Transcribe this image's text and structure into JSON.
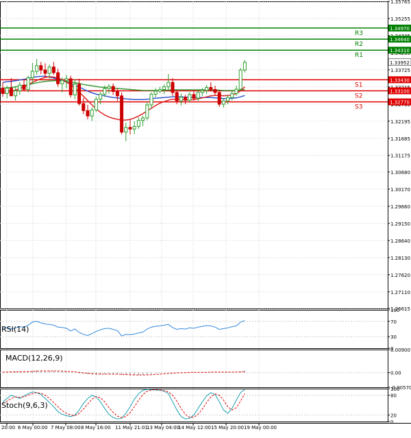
{
  "chart_data": {
    "type": "candlestick",
    "symbol_panel": "main",
    "colors": {
      "background": "#ffffff",
      "grid": "#cfcfcf",
      "bull": "#2e9e2e",
      "bear": "#cc0000",
      "resistance": "#008000",
      "support": "#e00000",
      "ma_blue": "#3355cc",
      "ma_green": "#3a9a3a",
      "ma_red": "#dd2222",
      "rsi_line": "#3388dd",
      "macd_signal": "#e00000",
      "macd_hist": "#888888",
      "stoch_main": "#1aa0b0",
      "stoch_signal": "#e00000",
      "price_tag": "#e00000",
      "last_price_bg": "#ffffff"
    },
    "price_axis_ticks": [
      "1.35765",
      "1.35255",
      "1.34745",
      "1.34235",
      "1.33725",
      "1.33215",
      "1.32705",
      "1.32195",
      "1.31685",
      "1.31175",
      "1.30680",
      "1.30170",
      "1.29660",
      "1.29150",
      "1.28640",
      "1.28130",
      "1.27620",
      "1.27110",
      "1.26615"
    ],
    "ylim": [
      1.26615,
      1.35765
    ],
    "levels": [
      {
        "name": "R3",
        "value": 1.3497,
        "label": "1.34970",
        "kind": "resistance"
      },
      {
        "name": "R2",
        "value": 1.3464,
        "label": "1.34640",
        "kind": "resistance"
      },
      {
        "name": "R1",
        "value": 1.3431,
        "label": "1.34310",
        "kind": "resistance"
      },
      {
        "name": "S1",
        "value": 1.3343,
        "label": "1.33430",
        "kind": "support"
      },
      {
        "name": "S2",
        "value": 1.331,
        "label": "1.33100",
        "kind": "support"
      },
      {
        "name": "S3",
        "value": 1.3277,
        "label": "1.32770",
        "kind": "support"
      }
    ],
    "last_price": {
      "value": 1.33952,
      "label": "1.33952"
    },
    "x_tick_labels": [
      "20:00",
      "6 May 00:00",
      "7 May 08:00",
      "8 May 16:00",
      "11 May 21:01",
      "13 May 04:00",
      "14 May 12:00",
      "15 May 20:00",
      "19 May 00:00"
    ],
    "candles": [
      {
        "o": 1.3318,
        "h": 1.3335,
        "l": 1.3292,
        "c": 1.3302
      },
      {
        "o": 1.3302,
        "h": 1.3325,
        "l": 1.3288,
        "c": 1.3318
      },
      {
        "o": 1.3318,
        "h": 1.3348,
        "l": 1.3304,
        "c": 1.3295
      },
      {
        "o": 1.3295,
        "h": 1.3322,
        "l": 1.3281,
        "c": 1.331
      },
      {
        "o": 1.331,
        "h": 1.3336,
        "l": 1.3298,
        "c": 1.3327
      },
      {
        "o": 1.3327,
        "h": 1.3345,
        "l": 1.3309,
        "c": 1.3314
      },
      {
        "o": 1.3314,
        "h": 1.3355,
        "l": 1.3306,
        "c": 1.3349
      },
      {
        "o": 1.3349,
        "h": 1.3393,
        "l": 1.333,
        "c": 1.3368
      },
      {
        "o": 1.3368,
        "h": 1.3405,
        "l": 1.3358,
        "c": 1.3385
      },
      {
        "o": 1.3385,
        "h": 1.3396,
        "l": 1.336,
        "c": 1.3372
      },
      {
        "o": 1.3372,
        "h": 1.3392,
        "l": 1.3351,
        "c": 1.3362
      },
      {
        "o": 1.3362,
        "h": 1.3388,
        "l": 1.3346,
        "c": 1.3381
      },
      {
        "o": 1.3381,
        "h": 1.3396,
        "l": 1.3358,
        "c": 1.3364
      },
      {
        "o": 1.3364,
        "h": 1.3376,
        "l": 1.3322,
        "c": 1.3331
      },
      {
        "o": 1.3331,
        "h": 1.335,
        "l": 1.3305,
        "c": 1.3341
      },
      {
        "o": 1.3341,
        "h": 1.3357,
        "l": 1.3318,
        "c": 1.3346
      },
      {
        "o": 1.3346,
        "h": 1.3355,
        "l": 1.329,
        "c": 1.3298
      },
      {
        "o": 1.3298,
        "h": 1.3345,
        "l": 1.3285,
        "c": 1.333
      },
      {
        "o": 1.333,
        "h": 1.3346,
        "l": 1.3266,
        "c": 1.3272
      },
      {
        "o": 1.3272,
        "h": 1.3289,
        "l": 1.324,
        "c": 1.3251
      },
      {
        "o": 1.3251,
        "h": 1.3268,
        "l": 1.3225,
        "c": 1.3235
      },
      {
        "o": 1.3235,
        "h": 1.3261,
        "l": 1.322,
        "c": 1.3253
      },
      {
        "o": 1.3253,
        "h": 1.3292,
        "l": 1.3247,
        "c": 1.3285
      },
      {
        "o": 1.3285,
        "h": 1.3306,
        "l": 1.327,
        "c": 1.33
      },
      {
        "o": 1.33,
        "h": 1.3326,
        "l": 1.3292,
        "c": 1.3317
      },
      {
        "o": 1.3317,
        "h": 1.333,
        "l": 1.3302,
        "c": 1.3323
      },
      {
        "o": 1.3323,
        "h": 1.3332,
        "l": 1.3298,
        "c": 1.3308
      },
      {
        "o": 1.3308,
        "h": 1.3318,
        "l": 1.328,
        "c": 1.3295
      },
      {
        "o": 1.3295,
        "h": 1.3305,
        "l": 1.318,
        "c": 1.3187
      },
      {
        "o": 1.3187,
        "h": 1.3215,
        "l": 1.316,
        "c": 1.3201
      },
      {
        "o": 1.3201,
        "h": 1.3225,
        "l": 1.318,
        "c": 1.3196
      },
      {
        "o": 1.3196,
        "h": 1.3219,
        "l": 1.3181,
        "c": 1.3204
      },
      {
        "o": 1.3204,
        "h": 1.3231,
        "l": 1.3197,
        "c": 1.3222
      },
      {
        "o": 1.3222,
        "h": 1.3236,
        "l": 1.3205,
        "c": 1.3229
      },
      {
        "o": 1.3229,
        "h": 1.3277,
        "l": 1.3222,
        "c": 1.3268
      },
      {
        "o": 1.3268,
        "h": 1.3305,
        "l": 1.3256,
        "c": 1.33
      },
      {
        "o": 1.33,
        "h": 1.3318,
        "l": 1.3291,
        "c": 1.3309
      },
      {
        "o": 1.3309,
        "h": 1.3322,
        "l": 1.3302,
        "c": 1.3314
      },
      {
        "o": 1.3314,
        "h": 1.3329,
        "l": 1.33,
        "c": 1.3322
      },
      {
        "o": 1.3322,
        "h": 1.336,
        "l": 1.3312,
        "c": 1.3335
      },
      {
        "o": 1.3335,
        "h": 1.3348,
        "l": 1.3295,
        "c": 1.3305
      },
      {
        "o": 1.3305,
        "h": 1.3312,
        "l": 1.327,
        "c": 1.328
      },
      {
        "o": 1.328,
        "h": 1.3302,
        "l": 1.3266,
        "c": 1.3291
      },
      {
        "o": 1.3291,
        "h": 1.3298,
        "l": 1.327,
        "c": 1.3282
      },
      {
        "o": 1.3282,
        "h": 1.3306,
        "l": 1.3276,
        "c": 1.3299
      },
      {
        "o": 1.3299,
        "h": 1.3311,
        "l": 1.3281,
        "c": 1.3288
      },
      {
        "o": 1.3288,
        "h": 1.3314,
        "l": 1.328,
        "c": 1.3305
      },
      {
        "o": 1.3305,
        "h": 1.3318,
        "l": 1.3295,
        "c": 1.3311
      },
      {
        "o": 1.3311,
        "h": 1.3327,
        "l": 1.3301,
        "c": 1.332
      },
      {
        "o": 1.332,
        "h": 1.3336,
        "l": 1.331,
        "c": 1.3314
      },
      {
        "o": 1.3314,
        "h": 1.3325,
        "l": 1.3297,
        "c": 1.3305
      },
      {
        "o": 1.3305,
        "h": 1.3312,
        "l": 1.3262,
        "c": 1.327
      },
      {
        "o": 1.327,
        "h": 1.3288,
        "l": 1.326,
        "c": 1.328
      },
      {
        "o": 1.328,
        "h": 1.3297,
        "l": 1.327,
        "c": 1.329
      },
      {
        "o": 1.329,
        "h": 1.331,
        "l": 1.3282,
        "c": 1.3302
      },
      {
        "o": 1.3302,
        "h": 1.3325,
        "l": 1.3295,
        "c": 1.3315
      },
      {
        "o": 1.3315,
        "h": 1.3378,
        "l": 1.331,
        "c": 1.3372
      },
      {
        "o": 1.3372,
        "h": 1.3402,
        "l": 1.3365,
        "c": 1.3395
      }
    ],
    "ma_blue": [
      1.3335,
      1.3337,
      1.3338,
      1.334,
      1.3342,
      1.3344,
      1.3347,
      1.335,
      1.3352,
      1.3353,
      1.3353,
      1.3351,
      1.3348,
      1.3344,
      1.334,
      1.3336,
      1.3331,
      1.3326,
      1.3321,
      1.3315,
      1.3309,
      1.3304,
      1.33,
      1.3297,
      1.3295,
      1.3292,
      1.329,
      1.3289,
      1.3287,
      1.3286,
      1.3285,
      1.3284,
      1.3284,
      1.3284,
      1.3285,
      1.3286,
      1.3288,
      1.3289,
      1.329,
      1.3291,
      1.3292,
      1.3292,
      1.3292,
      1.3291,
      1.3291,
      1.329,
      1.329,
      1.329,
      1.329,
      1.329,
      1.3289,
      1.3288,
      1.3287,
      1.3287,
      1.3288,
      1.3289,
      1.3292,
      1.3296
    ],
    "ma_green": [
      1.3318,
      1.3319,
      1.332,
      1.3322,
      1.3324,
      1.3326,
      1.3328,
      1.3331,
      1.3334,
      1.3336,
      1.3338,
      1.3339,
      1.334,
      1.334,
      1.3339,
      1.3338,
      1.3336,
      1.3334,
      1.3332,
      1.3329,
      1.3327,
      1.3325,
      1.3323,
      1.3321,
      1.332,
      1.3319,
      1.3318,
      1.3317,
      1.3316,
      1.3315,
      1.3314,
      1.3313,
      1.3312,
      1.3311,
      1.3311,
      1.3311,
      1.3311,
      1.3311,
      1.3312,
      1.3312,
      1.3313,
      1.3313,
      1.3313,
      1.3313,
      1.3313,
      1.3313,
      1.3313,
      1.3313,
      1.3313,
      1.3313,
      1.3312,
      1.3312,
      1.3311,
      1.3311,
      1.3311,
      1.3311,
      1.3312,
      1.3314
    ],
    "ma_red": [
      1.3302,
      1.3305,
      1.3308,
      1.3312,
      1.3317,
      1.3322,
      1.3328,
      1.3335,
      1.3341,
      1.3346,
      1.335,
      1.3352,
      1.3351,
      1.3348,
      1.3343,
      1.3336,
      1.3328,
      1.3318,
      1.3306,
      1.3294,
      1.3281,
      1.3268,
      1.3256,
      1.3246,
      1.3238,
      1.3232,
      1.3228,
      1.3225,
      1.3223,
      1.3223,
      1.3225,
      1.3229,
      1.3235,
      1.3242,
      1.325,
      1.3258,
      1.3266,
      1.3273,
      1.3278,
      1.3282,
      1.3285,
      1.3285,
      1.3284,
      1.3283,
      1.3283,
      1.3284,
      1.3286,
      1.3289,
      1.3292,
      1.3295,
      1.3296,
      1.3296,
      1.3295,
      1.3296,
      1.3298,
      1.3302,
      1.331,
      1.3322
    ],
    "rsi": {
      "label": "RSI(14)",
      "ticks": [
        "100",
        "70",
        "30",
        "0"
      ],
      "ylim": [
        0,
        100
      ],
      "values": [
        52,
        54,
        50,
        53,
        56,
        55,
        60,
        68,
        70,
        66,
        63,
        62,
        60,
        55,
        54,
        52,
        45,
        50,
        41,
        36,
        33,
        38,
        44,
        48,
        51,
        52,
        49,
        46,
        32,
        36,
        35,
        37,
        40,
        42,
        50,
        55,
        57,
        58,
        60,
        62,
        54,
        49,
        51,
        50,
        53,
        52,
        55,
        57,
        59,
        58,
        55,
        49,
        51,
        53,
        56,
        58,
        68,
        72
      ]
    },
    "macd": {
      "label": "MACD(12,26,9)",
      "ticks": [
        "0.009007",
        "0.00",
        "-0.005707"
      ],
      "ylim": [
        -0.005707,
        0.009007
      ],
      "hist": [
        0.0003,
        0.0003,
        0.0004,
        0.0004,
        0.0005,
        0.0005,
        0.0006,
        0.0008,
        0.0009,
        0.0009,
        0.0008,
        0.0008,
        0.0007,
        0.0005,
        0.0004,
        0.0003,
        0.0,
        -0.0001,
        -0.0003,
        -0.0005,
        -0.0007,
        -0.0008,
        -0.0008,
        -0.0008,
        -0.0007,
        -0.0006,
        -0.0006,
        -0.0006,
        -0.0009,
        -0.001,
        -0.0011,
        -0.0011,
        -0.001,
        -0.0009,
        -0.0007,
        -0.0005,
        -0.0003,
        -0.0002,
        0.0,
        0.0001,
        0.0001,
        0.0001,
        0.0001,
        0.0001,
        0.0001,
        0.0001,
        0.0002,
        0.0002,
        0.0002,
        0.0002,
        0.0002,
        0.0001,
        0.0001,
        0.0001,
        0.0001,
        0.0002,
        0.0005,
        0.0008
      ],
      "signal": [
        0.0002,
        0.0002,
        0.0003,
        0.0003,
        0.0003,
        0.0004,
        0.0004,
        0.0005,
        0.0006,
        0.0007,
        0.0007,
        0.0007,
        0.0007,
        0.0007,
        0.0006,
        0.0005,
        0.0004,
        0.0003,
        0.0001,
        -0.0001,
        -0.0002,
        -0.0004,
        -0.0005,
        -0.0006,
        -0.0006,
        -0.0006,
        -0.0006,
        -0.0006,
        -0.0007,
        -0.0007,
        -0.0008,
        -0.0009,
        -0.0009,
        -0.0009,
        -0.0009,
        -0.0008,
        -0.0007,
        -0.0006,
        -0.0004,
        -0.0003,
        -0.0002,
        -0.0001,
        0.0,
        0.0,
        0.0001,
        0.0001,
        0.0001,
        0.0001,
        0.0001,
        0.0002,
        0.0002,
        0.0002,
        0.0002,
        0.0002,
        0.0002,
        0.0002,
        0.0003,
        0.0004
      ]
    },
    "stoch": {
      "label": "Stoch(9,6,3)",
      "ticks": [
        "100",
        "80",
        "20",
        "0"
      ],
      "ylim": [
        0,
        100
      ],
      "main": [
        60,
        70,
        80,
        75,
        70,
        78,
        85,
        90,
        88,
        82,
        70,
        58,
        45,
        30,
        22,
        18,
        15,
        20,
        35,
        55,
        70,
        80,
        75,
        60,
        40,
        22,
        12,
        8,
        10,
        25,
        45,
        68,
        85,
        95,
        98,
        97,
        96,
        95,
        92,
        85,
        60,
        35,
        15,
        8,
        10,
        20,
        40,
        60,
        78,
        88,
        82,
        60,
        35,
        25,
        40,
        65,
        88,
        98
      ],
      "signal": [
        55,
        62,
        70,
        75,
        74,
        75,
        80,
        85,
        88,
        86,
        80,
        70,
        58,
        45,
        33,
        25,
        20,
        18,
        25,
        38,
        53,
        68,
        76,
        72,
        60,
        42,
        28,
        16,
        12,
        15,
        27,
        45,
        65,
        82,
        92,
        96,
        97,
        96,
        94,
        90,
        80,
        62,
        40,
        22,
        13,
        13,
        22,
        38,
        58,
        75,
        84,
        80,
        65,
        45,
        35,
        42,
        62,
        85
      ]
    }
  }
}
